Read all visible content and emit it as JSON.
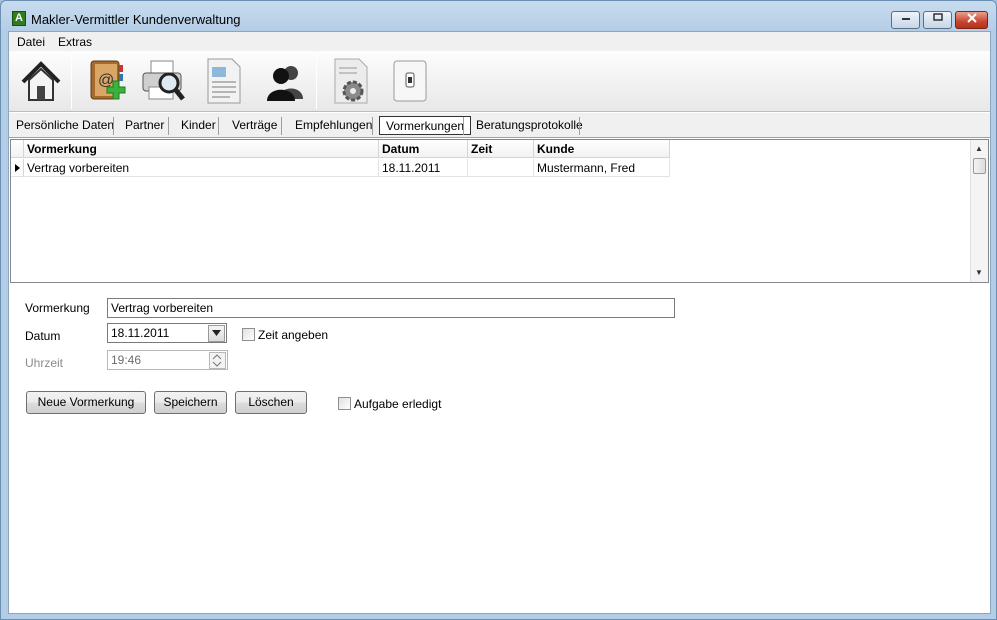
{
  "window": {
    "title": "Makler-Vermittler Kundenverwaltung",
    "app_icon_letter": "A"
  },
  "menu": {
    "items": [
      {
        "label": "Datei"
      },
      {
        "label": "Extras"
      }
    ]
  },
  "toolbar": {
    "buttons": [
      {
        "icon": "home-icon"
      },
      {
        "icon": "address-book-add-icon"
      },
      {
        "icon": "print-preview-icon"
      },
      {
        "icon": "document-icon"
      },
      {
        "icon": "users-icon"
      },
      {
        "icon": "settings-document-icon"
      },
      {
        "icon": "power-switch-icon"
      }
    ]
  },
  "tabs": [
    {
      "label": "Persönliche Daten"
    },
    {
      "label": "Partner"
    },
    {
      "label": "Kinder"
    },
    {
      "label": "Verträge"
    },
    {
      "label": "Empfehlungen"
    },
    {
      "label": "Vormerkungen",
      "active": true
    },
    {
      "label": "Beratungsprotokolle"
    }
  ],
  "grid": {
    "columns": [
      "Vormerkung",
      "Datum",
      "Zeit",
      "Kunde"
    ],
    "rows": [
      {
        "vormerkung": "Vertrag vorbereiten",
        "datum": "18.11.2011",
        "zeit": "",
        "kunde": "Mustermann, Fred"
      }
    ]
  },
  "form": {
    "vormerkung_label": "Vormerkung",
    "vormerkung_value": "Vertrag vorbereiten",
    "datum_label": "Datum",
    "datum_value": "18.11.2011",
    "zeit_angeben_label": "Zeit angeben",
    "zeit_angeben_checked": false,
    "uhrzeit_label": "Uhrzeit",
    "uhrzeit_value": "19:46",
    "aufgabe_erledigt_label": "Aufgabe erledigt",
    "aufgabe_erledigt_checked": false
  },
  "buttons": {
    "neue": "Neue Vormerkung",
    "speichern": "Speichern",
    "loeschen": "Löschen"
  }
}
